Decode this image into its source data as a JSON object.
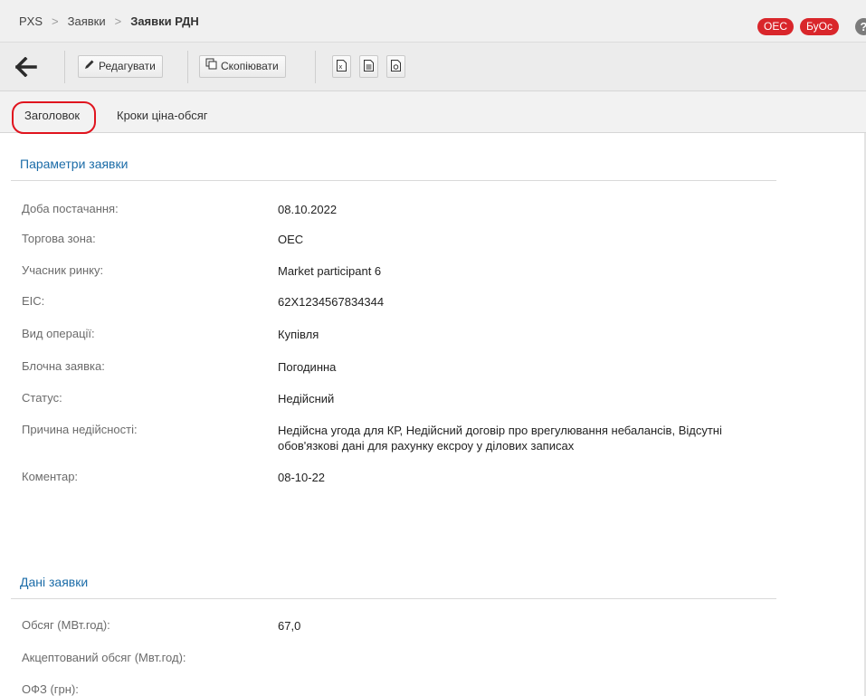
{
  "breadcrumb": {
    "root": "PXS",
    "level1": "Заявки",
    "current": "Заявки РДН",
    "separator": ">"
  },
  "badges": {
    "oec": "OEC",
    "buoc": "БуОс"
  },
  "help": {
    "glyph": "?"
  },
  "toolbar": {
    "back_icon": "arrow-left-icon",
    "edit_label": "Редагувати",
    "copy_label": "Скопіювати",
    "export_icons": [
      "excel-export-icon",
      "document-icon",
      "pdf-icon"
    ]
  },
  "tabs": [
    {
      "label": "Заголовок",
      "active": true
    },
    {
      "label": "Кроки ціна-обсяг",
      "active": false
    }
  ],
  "sections": {
    "params": {
      "title": "Параметри заявки",
      "fields": [
        {
          "label": "Доба постачання:",
          "value": "08.10.2022"
        },
        {
          "label": "Торгова зона:",
          "value": "OEC"
        },
        {
          "label": "Учасник ринку:",
          "value": "Market participant 6"
        },
        {
          "label": "EIC:",
          "value": "62X1234567834344"
        },
        {
          "label": "Вид операції:",
          "value": "Купівля"
        },
        {
          "label": "Блочна заявка:",
          "value": "Погодинна"
        },
        {
          "label": "Статус:",
          "value": "Недійсний"
        },
        {
          "label": "Причина недійсності:",
          "value": "Недійсна угода для КР, Недійсний договір про врегулювання небалансів, Відсутні обов'язкові дані для рахунку ексроу у ділових записах"
        },
        {
          "label": "Коментар:",
          "value": "08-10-22"
        }
      ]
    },
    "data": {
      "title": "Дані заявки",
      "fields": [
        {
          "label": "Обсяг (МВт.год):",
          "value": "67,0"
        },
        {
          "label": "Акцептований обсяг (Мвт.год):",
          "value": ""
        },
        {
          "label": "ОФЗ (грн):",
          "value": ""
        }
      ]
    }
  },
  "colors": {
    "accent": "#1b6ca8",
    "badge": "#d9262b",
    "highlight": "#e0141e"
  }
}
